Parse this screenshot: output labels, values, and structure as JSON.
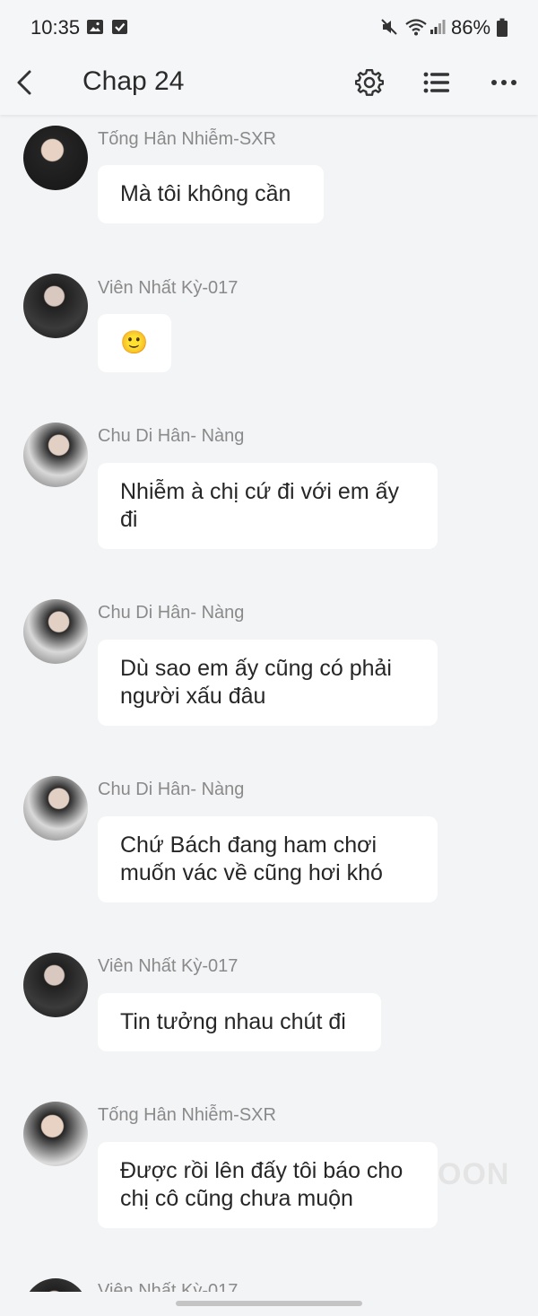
{
  "status": {
    "time": "10:35",
    "battery": "86%",
    "left_icons": [
      "image-icon",
      "checkbox-icon"
    ],
    "right_icons": [
      "mute-icon",
      "wifi-icon",
      "signal-icon",
      "battery-icon"
    ]
  },
  "header": {
    "title": "Chap 24",
    "icons": [
      "back-arrow-icon",
      "gear-icon",
      "list-icon",
      "more-icon"
    ]
  },
  "messages": [
    {
      "name": "Tống Hân Nhiễm-SXR",
      "text": "Mà tôi không cần"
    },
    {
      "name": "Viên Nhất Kỳ-017",
      "text": "🙂"
    },
    {
      "name": "Chu Di Hân- Nàng",
      "text": "Nhiễm à chị cứ đi với em ấy đi"
    },
    {
      "name": "Chu Di Hân- Nàng",
      "text": "Dù sao em ấy cũng có phải người xấu đâu"
    },
    {
      "name": "Chu Di Hân- Nàng",
      "text": "Chứ Bách đang ham chơi muốn vác về cũng hơi khó"
    },
    {
      "name": "Viên Nhất Kỳ-017",
      "text": "Tin tưởng nhau chút đi"
    },
    {
      "name": "Tống Hân Nhiễm-SXR",
      "text": "Được rồi lên đấy tôi báo cho chị cô cũng chưa muộn"
    },
    {
      "name": "Viên Nhất Kỳ-017",
      "text": ""
    }
  ],
  "watermark": "OON"
}
